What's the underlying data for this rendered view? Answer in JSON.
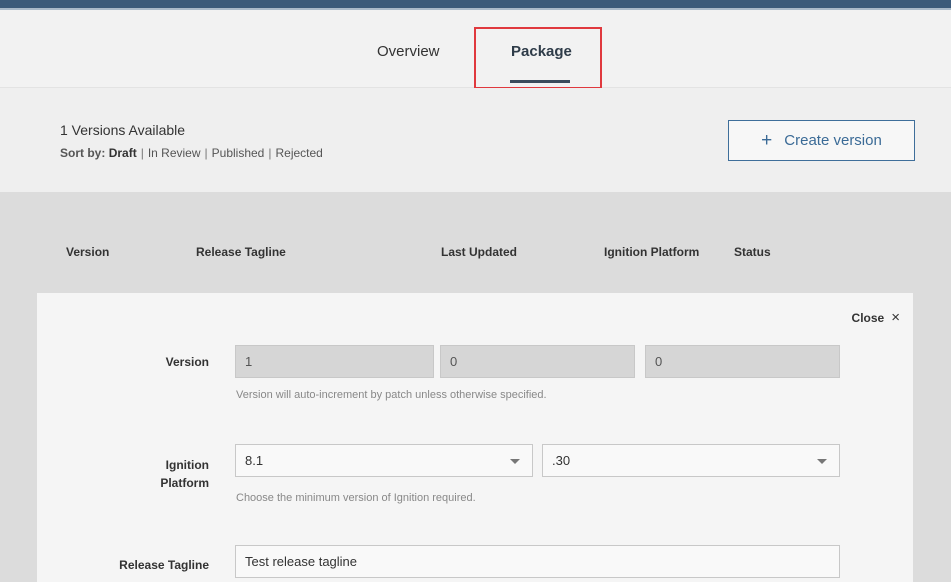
{
  "tabs": {
    "overview": "Overview",
    "package": "Package"
  },
  "versions": {
    "title": "1 Versions Available",
    "sort_label": "Sort by:",
    "sort_options": [
      "Draft",
      "In Review",
      "Published",
      "Rejected"
    ],
    "create_button_label": "Create version",
    "create_button_icon": "+"
  },
  "table": {
    "columns": [
      "Version",
      "Release Tagline",
      "Last Updated",
      "Ignition Platform",
      "Status"
    ]
  },
  "panel": {
    "close_label": "Close",
    "close_icon": "×",
    "version_label": "Version",
    "version_values": [
      "1",
      "0",
      "0"
    ],
    "version_hint": "Version will auto-increment by patch unless otherwise specified.",
    "platform_label_1": "Ignition",
    "platform_label_2": "Platform",
    "platform_major": "8.1",
    "platform_minor": ".30",
    "platform_hint": "Choose the minimum version of Ignition required.",
    "tagline_label": "Release Tagline",
    "tagline_value": "Test release tagline"
  },
  "colors": {
    "accent": "#3e6e9a",
    "highlight": "#e0393e",
    "topbar": "#3b5a7a"
  }
}
